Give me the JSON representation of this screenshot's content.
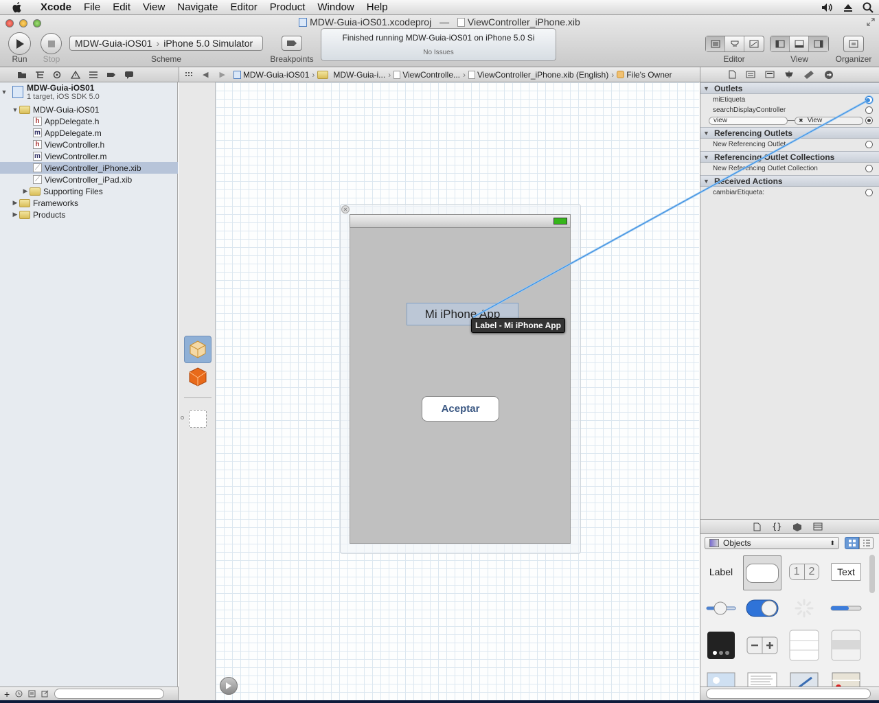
{
  "menubar": {
    "app": "Xcode",
    "items": [
      "File",
      "Edit",
      "View",
      "Navigate",
      "Editor",
      "Product",
      "Window",
      "Help"
    ]
  },
  "window": {
    "title_project": "MDW-Guia-iOS01.xcodeproj",
    "title_dash": "—",
    "title_file": "ViewController_iPhone.xib"
  },
  "toolbar": {
    "run_label": "Run",
    "stop_label": "Stop",
    "scheme_target": "MDW-Guia-iOS01",
    "scheme_device": "iPhone 5.0 Simulator",
    "scheme_label": "Scheme",
    "breakpoints_label": "Breakpoints",
    "activity_status": "Finished running MDW-Guia-iOS01 on iPhone 5.0 Si",
    "activity_issues": "No Issues",
    "editor_label": "Editor",
    "view_label": "View",
    "organizer_label": "Organizer"
  },
  "jumpbar": {
    "items": [
      "MDW-Guia-iOS01",
      "MDW-Guia-i...",
      "ViewControlle...",
      "ViewController_iPhone.xib (English)",
      "File's Owner"
    ]
  },
  "navigator": {
    "project_name": "MDW-Guia-iOS01",
    "project_sub": "1 target, iOS SDK 5.0",
    "group": "MDW-Guia-iOS01",
    "files": [
      {
        "name": "AppDelegate.h",
        "kind": "h"
      },
      {
        "name": "AppDelegate.m",
        "kind": "m"
      },
      {
        "name": "ViewController.h",
        "kind": "h"
      },
      {
        "name": "ViewController.m",
        "kind": "m"
      },
      {
        "name": "ViewController_iPhone.xib",
        "kind": "xib"
      },
      {
        "name": "ViewController_iPad.xib",
        "kind": "xib"
      }
    ],
    "subgroup": "Supporting Files",
    "frameworks": "Frameworks",
    "products": "Products"
  },
  "canvas": {
    "label_text": "Mi iPhone App",
    "button_text": "Aceptar",
    "tooltip": "Label - Mi iPhone App"
  },
  "inspector": {
    "outlets_header": "Outlets",
    "outlets": [
      "miEtiqueta",
      "searchDisplayController",
      "view"
    ],
    "view_connection": "View",
    "ref_outlets_header": "Referencing Outlets",
    "new_ref_outlet": "New Referencing Outlet",
    "ref_collections_header": "Referencing Outlet Collections",
    "new_ref_collection": "New Referencing Outlet Collection",
    "received_actions_header": "Received Actions",
    "action": "cambiarEtiqueta:"
  },
  "library": {
    "selector": "Objects",
    "label_item": "Label",
    "segmented_item_1": "1",
    "segmented_item_2": "2",
    "text_item": "Text"
  },
  "colors": {
    "selection": "#b7c4d9",
    "connection_line": "#4a9be0",
    "canvas_view": "#c0c0c0",
    "button_text": "#3b5883"
  }
}
